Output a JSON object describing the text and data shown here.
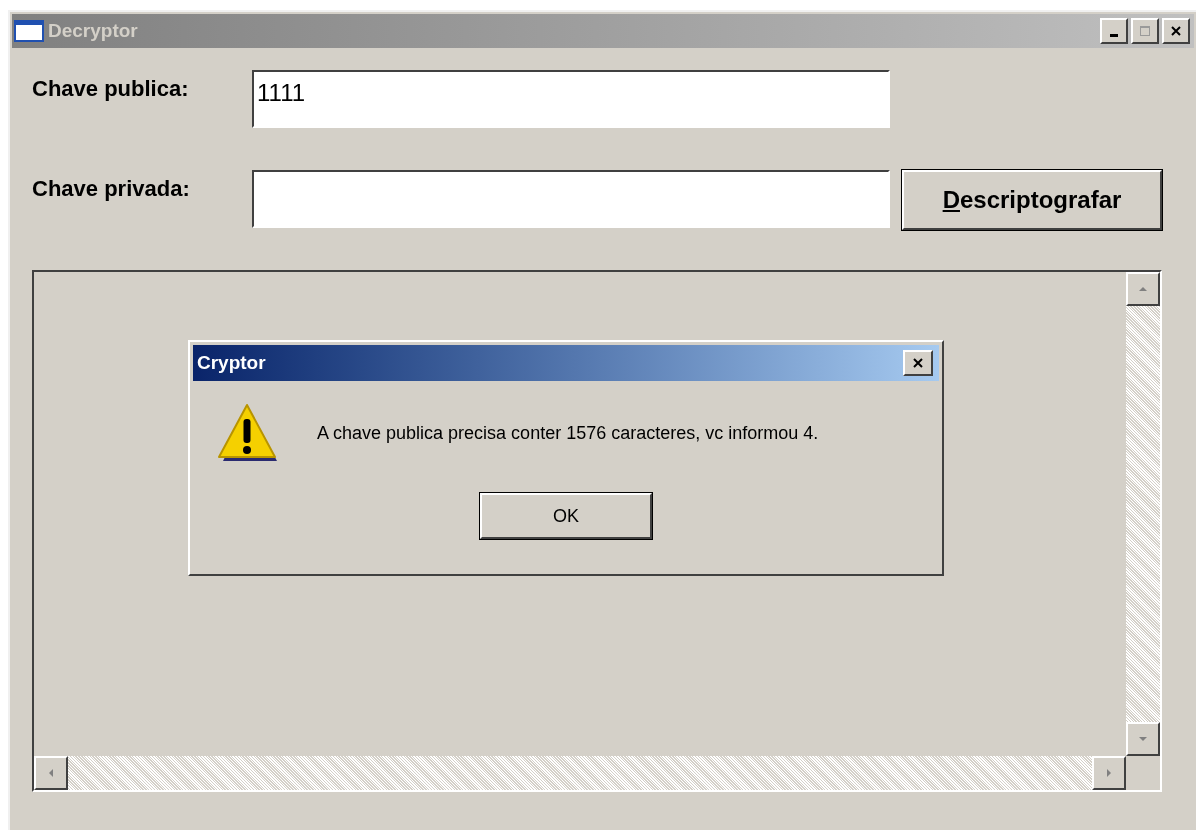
{
  "window": {
    "title": "Decryptor",
    "active": false,
    "controls": [
      {
        "kind": "minimize"
      },
      {
        "kind": "maximize"
      },
      {
        "kind": "close"
      }
    ]
  },
  "fields": [
    {
      "label": "Chave publica:",
      "value": "1111"
    },
    {
      "label": "Chave privada:"
    }
  ],
  "decrypt_button": {
    "label": "Descriptografar",
    "mnemonic_underlined": true
  },
  "dialog": {
    "title": "Cryptor",
    "active": true,
    "message": "A chave publica precisa conter 1576 caracteres, vc informou 4.",
    "buttons": [
      "OK"
    ]
  }
}
